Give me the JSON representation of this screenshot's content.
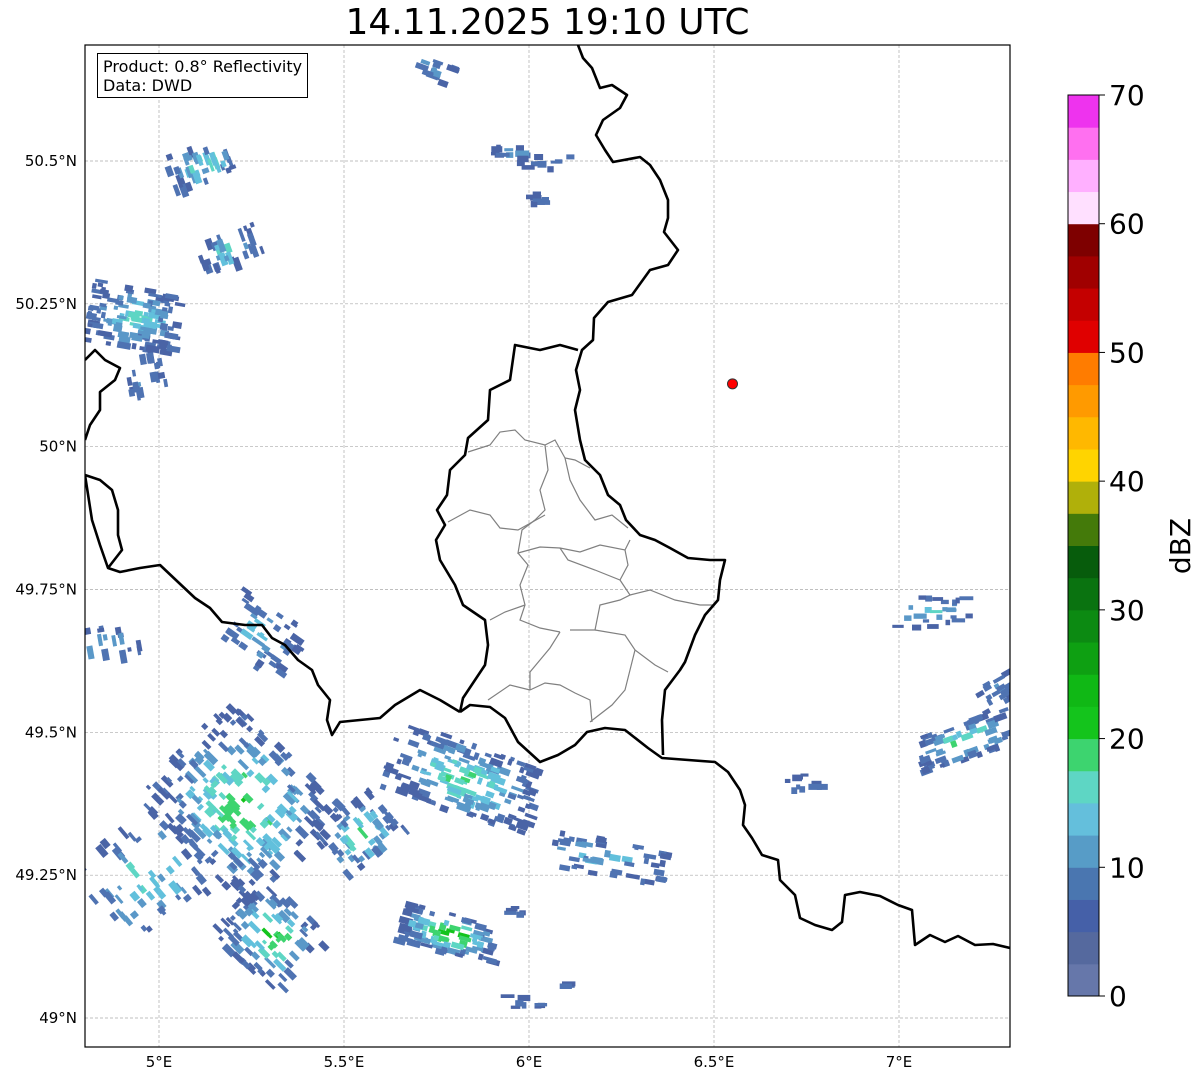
{
  "title": "14.11.2025 19:10 UTC",
  "info": {
    "product": "Product: 0.8° Reflectivity",
    "data": "Data: DWD"
  },
  "axes": {
    "x_ticks": [
      {
        "value": 5.0,
        "label": "5°E"
      },
      {
        "value": 5.5,
        "label": "5.5°E"
      },
      {
        "value": 6.0,
        "label": "6°E"
      },
      {
        "value": 6.5,
        "label": "6.5°E"
      },
      {
        "value": 7.0,
        "label": "7°E"
      }
    ],
    "y_ticks": [
      {
        "value": 50.5,
        "label": "50.5°N"
      },
      {
        "value": 50.25,
        "label": "50.25°N"
      },
      {
        "value": 50.0,
        "label": "50°N"
      },
      {
        "value": 49.75,
        "label": "49.75°N"
      },
      {
        "value": 49.5,
        "label": "49.5°N"
      },
      {
        "value": 49.25,
        "label": "49.25°N"
      },
      {
        "value": 49.0,
        "label": "49°N"
      }
    ],
    "lon_range": [
      4.8,
      7.3
    ],
    "lat_range": [
      48.95,
      50.7
    ],
    "grid": true
  },
  "colorbar": {
    "label": "dBZ",
    "ticks": [
      "0",
      "10",
      "20",
      "30",
      "40",
      "50",
      "60",
      "70"
    ],
    "range": [
      0,
      70
    ],
    "colors": [
      "#6677aa",
      "#55699e",
      "#4560a8",
      "#4a76b0",
      "#579cc7",
      "#64bfdc",
      "#5ed6c4",
      "#3dd46f",
      "#14c41c",
      "#10b815",
      "#0ea012",
      "#0c8a12",
      "#0a7310",
      "#075c0c",
      "#447a0a",
      "#b0b00a",
      "#ffd400",
      "#ffb800",
      "#ff9a00",
      "#ff7c00",
      "#e00000",
      "#c40000",
      "#a00000",
      "#7e0000",
      "#ffe0ff",
      "#ffb0ff",
      "#ff70f0",
      "#ee33ee"
    ]
  },
  "marker": {
    "lon": 6.55,
    "lat": 50.11,
    "color": "#ff0000"
  }
}
